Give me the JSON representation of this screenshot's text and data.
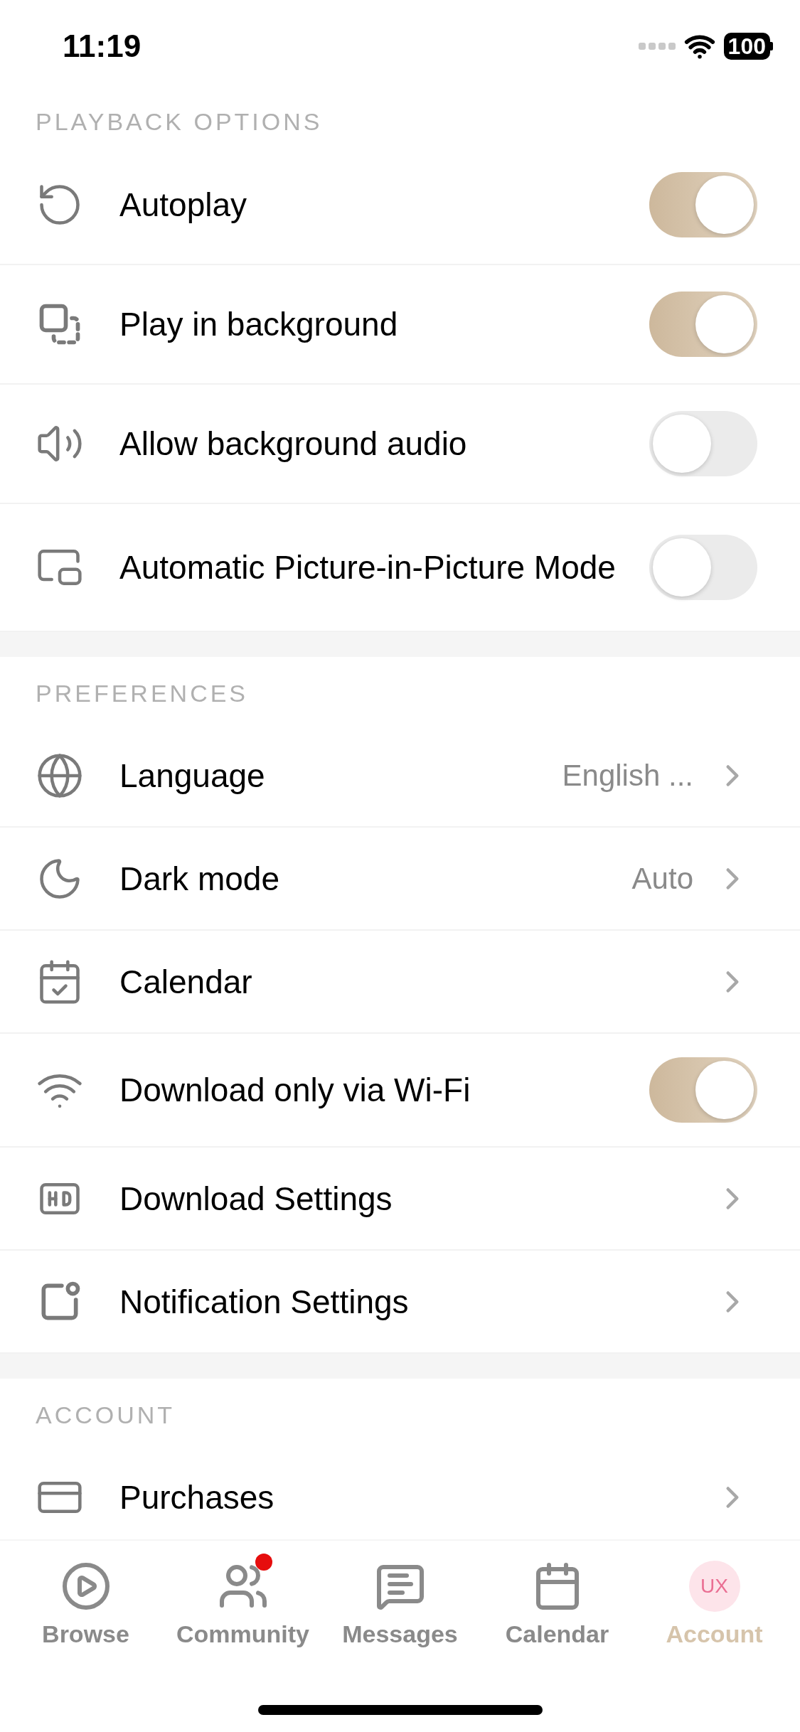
{
  "status_bar": {
    "time": "11:19",
    "battery": "100"
  },
  "sections": [
    {
      "title": "PLAYBACK OPTIONS",
      "items": [
        {
          "kind": "toggle",
          "label": "Autoplay",
          "on": true
        },
        {
          "kind": "toggle",
          "label": "Play in background",
          "on": true
        },
        {
          "kind": "toggle",
          "label": "Allow background audio",
          "on": false
        },
        {
          "kind": "toggle",
          "label": "Automatic Picture-in-Picture Mode",
          "on": false
        }
      ]
    },
    {
      "title": "PREFERENCES",
      "items": [
        {
          "kind": "link",
          "label": "Language",
          "value": "English ..."
        },
        {
          "kind": "link",
          "label": "Dark mode",
          "value": "Auto"
        },
        {
          "kind": "link",
          "label": "Calendar"
        },
        {
          "kind": "toggle",
          "label": "Download only via Wi-Fi",
          "on": true
        },
        {
          "kind": "link",
          "label": "Download Settings"
        },
        {
          "kind": "link",
          "label": "Notification Settings"
        }
      ]
    },
    {
      "title": "ACCOUNT",
      "items": [
        {
          "kind": "link",
          "label": "Purchases"
        }
      ]
    }
  ],
  "tab_bar": [
    {
      "kind": "icon",
      "label": "Browse",
      "selected": false,
      "badge": false
    },
    {
      "kind": "icon",
      "label": "Community",
      "selected": false,
      "badge": true
    },
    {
      "kind": "icon",
      "label": "Messages",
      "selected": false,
      "badge": false
    },
    {
      "kind": "icon",
      "label": "Calendar",
      "selected": false,
      "badge": false
    },
    {
      "kind": "avatar",
      "label": "Account",
      "selected": true,
      "badge": false,
      "avatar_text": "UX"
    }
  ]
}
